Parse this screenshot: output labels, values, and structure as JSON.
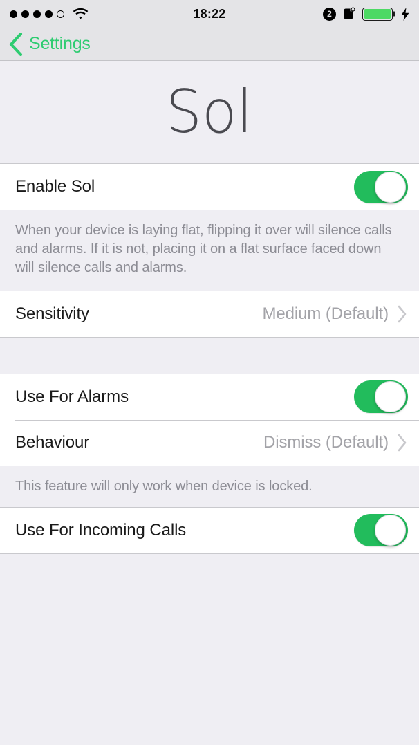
{
  "status_bar": {
    "signal_dots_filled": 4,
    "signal_dots_total": 5,
    "wifi_icon": "wifi-icon",
    "time": "18:22",
    "alarm_badge": "2",
    "rotation_lock_icon": "rotation-lock-icon",
    "battery_icon": "battery-icon",
    "battery_level_percent": 100,
    "charging_icon": "bolt-icon",
    "battery_color": "#4cd964"
  },
  "nav": {
    "back_icon": "chevron-left-icon",
    "back_label": "Settings",
    "tint_color": "#2ecc71"
  },
  "header": {
    "title": "Sol"
  },
  "sections": [
    {
      "rows": [
        {
          "label": "Enable Sol",
          "control": "toggle",
          "value": "on"
        }
      ],
      "footer": "When your device is laying flat, flipping it over will silence calls and alarms. If it is not, placing it on a flat surface faced down will silence calls and alarms."
    },
    {
      "rows": [
        {
          "label": "Sensitivity",
          "control": "disclosure",
          "value": "Medium (Default)"
        }
      ],
      "footer": ""
    },
    {
      "rows": [
        {
          "label": "Use For Alarms",
          "control": "toggle",
          "value": "on"
        },
        {
          "label": "Behaviour",
          "control": "disclosure",
          "value": "Dismiss (Default)"
        }
      ],
      "footer": "This feature will only work when device is locked."
    },
    {
      "rows": [
        {
          "label": "Use For Incoming Calls",
          "control": "toggle",
          "value": "on"
        }
      ],
      "footer": ""
    }
  ],
  "colors": {
    "toggle_on": "#22bc5c",
    "background": "#efeef3",
    "row_background": "#ffffff",
    "separator": "#c9c9cd",
    "value_text": "#a3a3a8",
    "footer_text": "#8c8c94"
  }
}
